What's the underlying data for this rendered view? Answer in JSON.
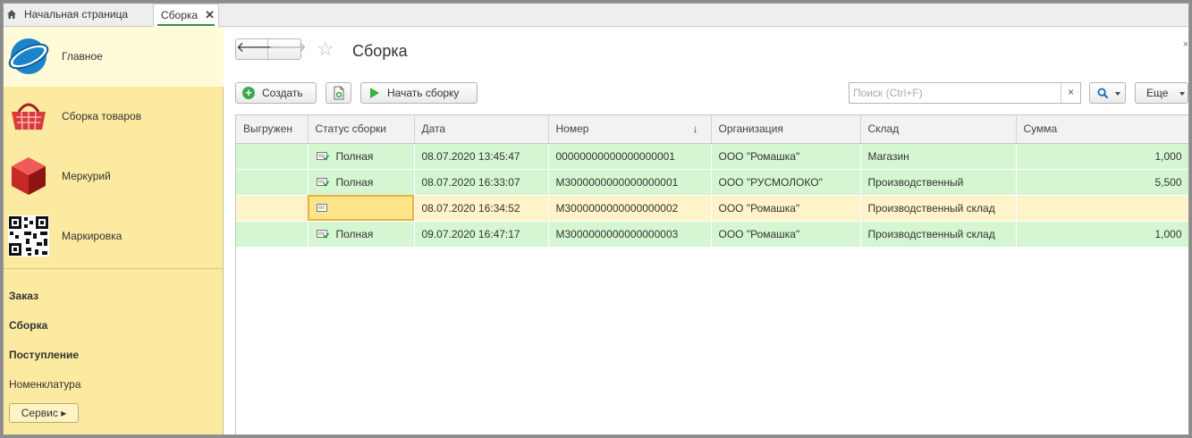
{
  "tabs": {
    "home_label": "Начальная страница",
    "active_label": "Сборка",
    "close_glyph": "✕"
  },
  "sidebar": {
    "sections": [
      {
        "label": "Главное",
        "icon": "globe-logo-icon"
      },
      {
        "label": "Сборка товаров",
        "icon": "basket-icon"
      },
      {
        "label": "Меркурий",
        "icon": "red-cube-icon"
      },
      {
        "label": "Маркировка",
        "icon": "qr-code-icon"
      }
    ],
    "links": [
      {
        "label": "Заказ",
        "bold": true
      },
      {
        "label": "Сборка",
        "bold": true
      },
      {
        "label": "Поступление",
        "bold": true
      },
      {
        "label": "Номенклатура",
        "bold": false
      }
    ],
    "service_label": "Сервис ▸"
  },
  "form": {
    "title": "Сборка",
    "back_glyph": "🡐",
    "forward_glyph": "🡒",
    "star_glyph": "☆",
    "close_glyph": "×"
  },
  "toolbar": {
    "create_label": "Создать",
    "start_label": "Начать сборку",
    "search_placeholder": "Поиск (Ctrl+F)",
    "search_value": "",
    "clear_glyph": "×",
    "more_label": "Еще"
  },
  "table": {
    "columns": [
      "Выгружен",
      "Статус сборки",
      "Дата",
      "Номер",
      "Организация",
      "Склад",
      "Сумма"
    ],
    "sort_glyph": "↓",
    "rows": [
      {
        "exported": "",
        "status": "Полная",
        "date": "08.07.2020 13:45:47",
        "number": "00000000000000000001",
        "org": "ООО \"Ромашка\"",
        "warehouse": "Магазин",
        "sum": "1,000",
        "color": "green"
      },
      {
        "exported": "",
        "status": "Полная",
        "date": "08.07.2020 16:33:07",
        "number": "М3000000000000000001",
        "org": "ООО \"РУСМОЛОКО\"",
        "warehouse": "Производственный",
        "sum": "5,500",
        "color": "green"
      },
      {
        "exported": "",
        "status": "",
        "date": "08.07.2020 16:34:52",
        "number": "М3000000000000000002",
        "org": "ООО \"Ромашка\"",
        "warehouse": "Производственный склад",
        "sum": "",
        "color": "yellow"
      },
      {
        "exported": "",
        "status": "Полная",
        "date": "09.07.2020 16:47:17",
        "number": "М3000000000000000003",
        "org": "ООО \"Ромашка\"",
        "warehouse": "Производственный склад",
        "sum": "1,000",
        "color": "green"
      }
    ]
  },
  "colors": {
    "sidebar_bg": "#fbeaa0",
    "row_complete": "#d4f7d2",
    "row_pending": "#fff3c9",
    "accent_green": "#3fa84a"
  }
}
